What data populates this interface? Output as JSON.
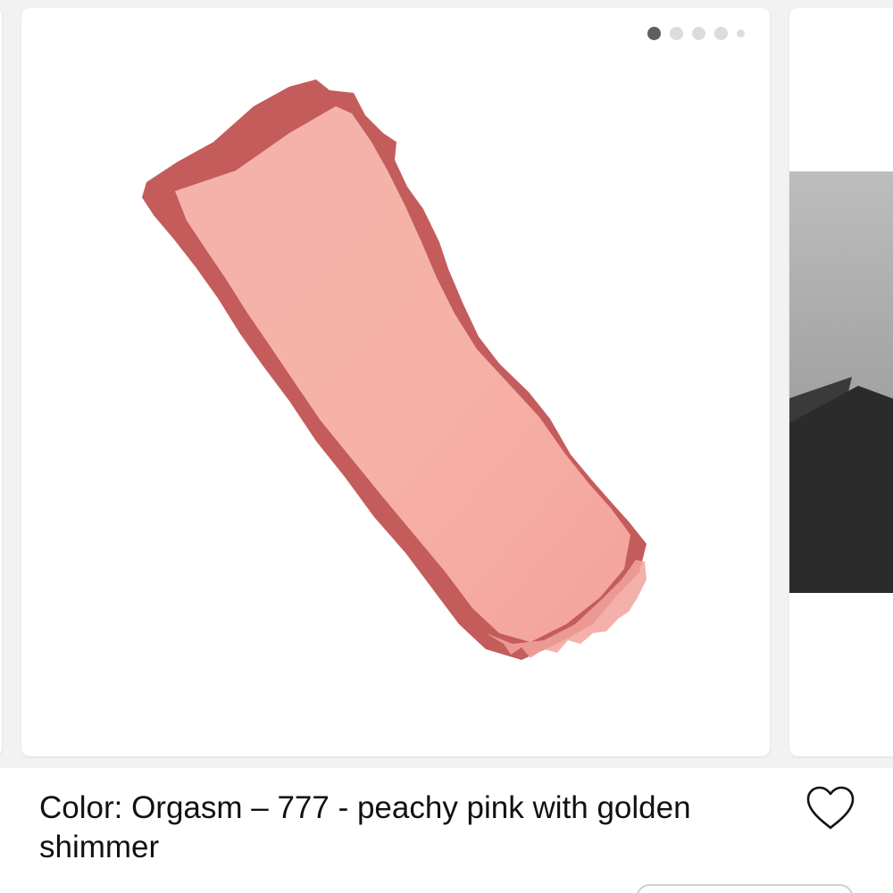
{
  "product": {
    "caption": "Color: Orgasm – 777 - peachy pink with golden shimmer"
  },
  "carousel": {
    "total_slides": 5,
    "active_slide": 1
  },
  "icons": {
    "favorite": "heart-icon"
  },
  "colors": {
    "swatch_edge": "#c05a5a",
    "swatch_fill": "#f5aaa3",
    "dot_active": "#5f5f5f",
    "dot_inactive": "#dcdcdc"
  }
}
